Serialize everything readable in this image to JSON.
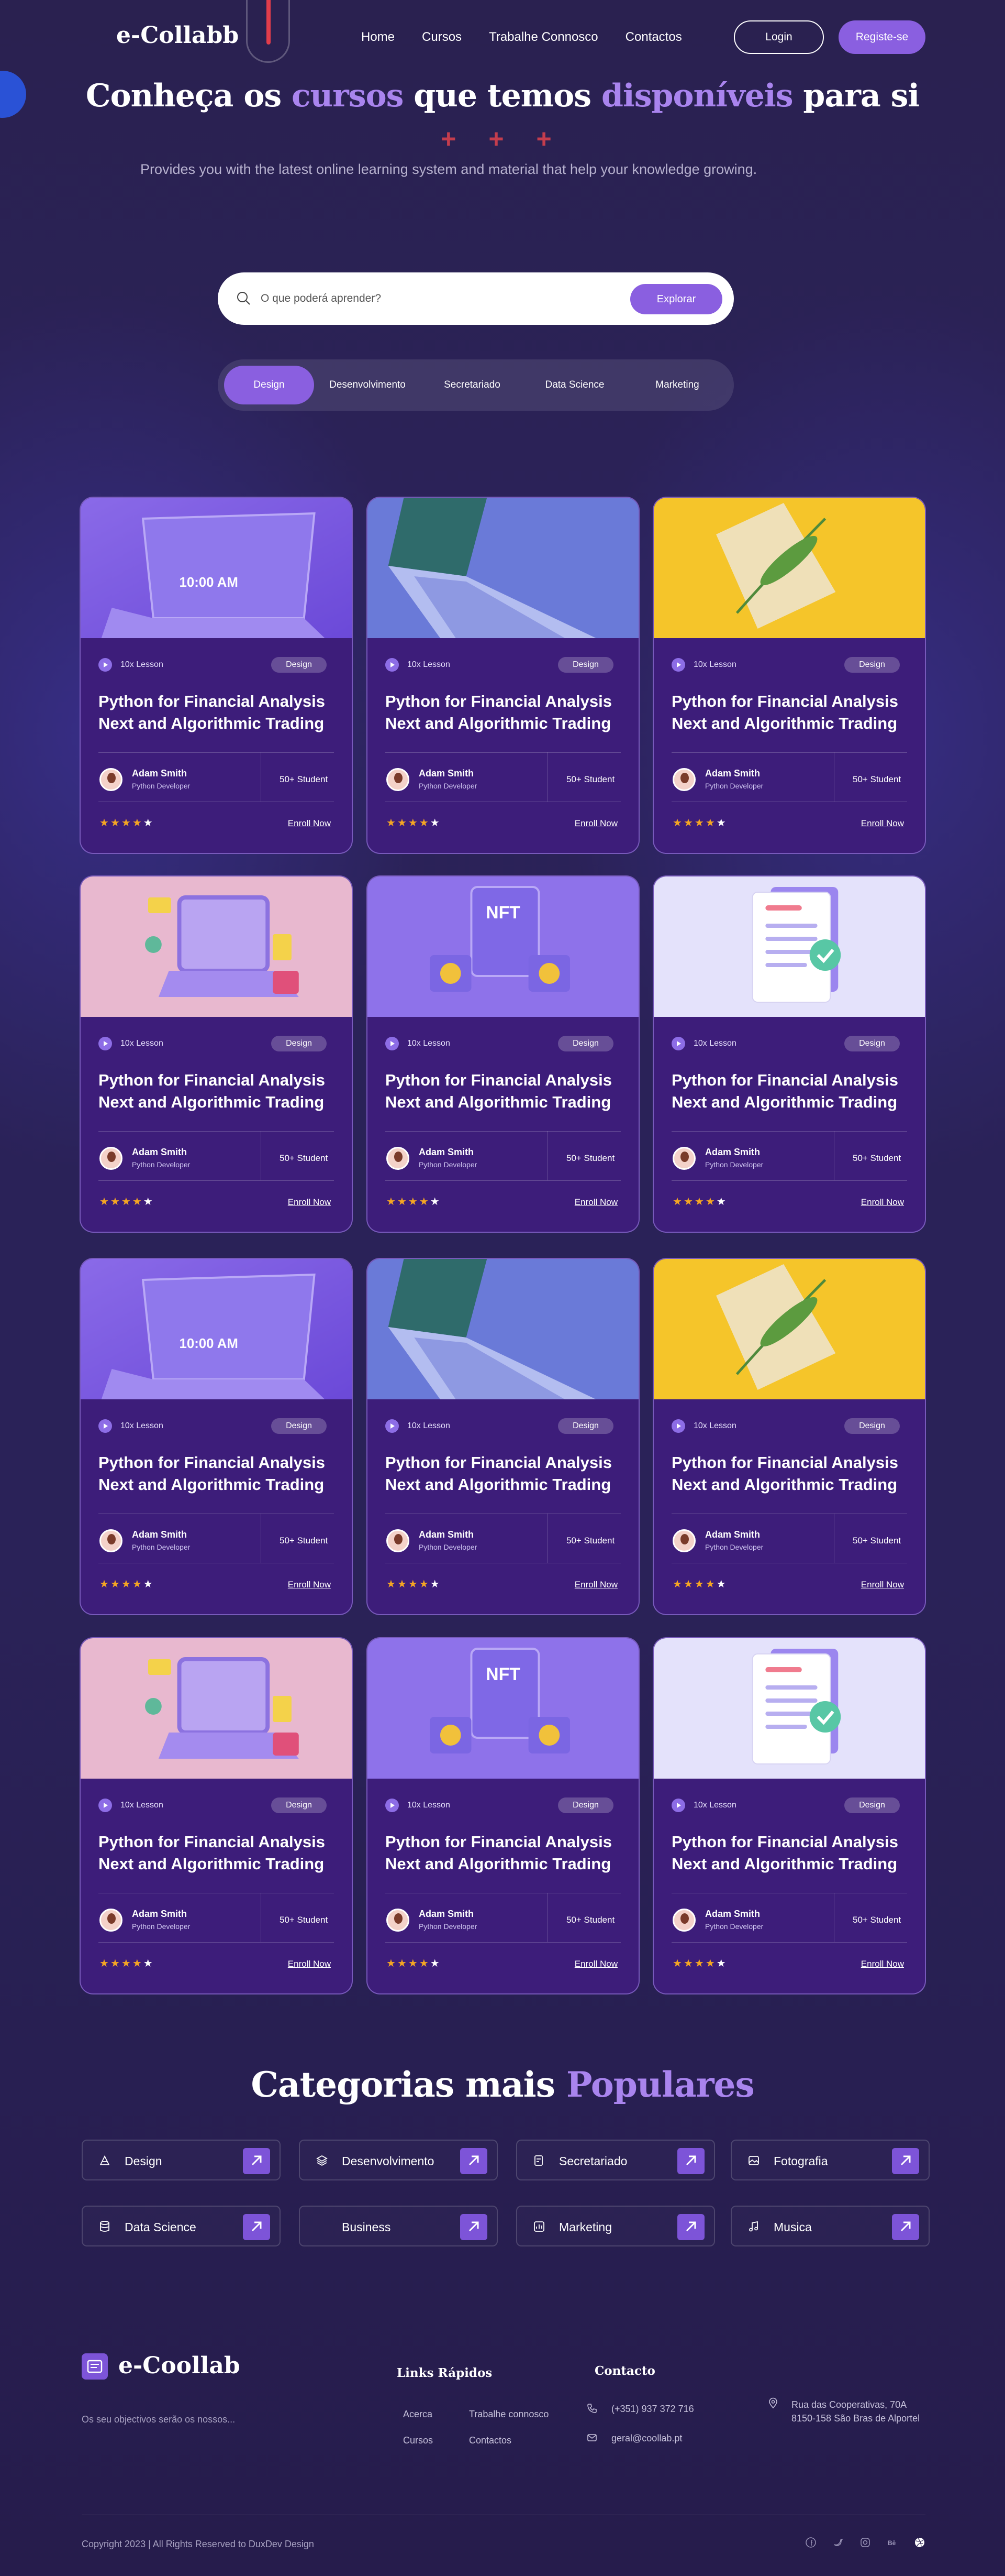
{
  "nav": {
    "logo": "e-Collabb",
    "links": [
      "Home",
      "Cursos",
      "Trabalhe Connosco",
      "Contactos"
    ],
    "login": "Login",
    "register": "Registe-se"
  },
  "hero": {
    "title_1": "Conheça os ",
    "title_hl1": "cursos",
    "title_2": " que temos ",
    "title_hl2": "disponíveis",
    "title_3": " para si",
    "plus": "+ + +",
    "subtitle": "Provides you with the latest online learning system and material that help your knowledge growing."
  },
  "search": {
    "placeholder": "O que poderá aprender?",
    "button": "Explorar"
  },
  "tabs": [
    {
      "label": "Design",
      "active": true
    },
    {
      "label": "Desenvolvimento",
      "active": false
    },
    {
      "label": "Secretariado",
      "active": false
    },
    {
      "label": "Data Science",
      "active": false
    },
    {
      "label": "Marketing",
      "active": false
    }
  ],
  "course_card": {
    "lesson": "10x Lesson",
    "tag": "Design",
    "title": "Python for Financial Analysis Next and Algorithmic Trading",
    "author": "Adam Smith",
    "role": "Python Developer",
    "students": "50+ Student",
    "rating": 4,
    "rating_max": 5,
    "enroll": "Enroll Now"
  },
  "course_images": [
    "laptop-purple",
    "laptop-blue",
    "plant-yellow",
    "laptop-pink",
    "nft-purple",
    "document-lavender"
  ],
  "course_image_text": {
    "time": "10:00 AM",
    "nft": "NFT"
  },
  "colors": {
    "accent": "#8a5fe0",
    "card_bg": "#3d1d7a",
    "star": "#f5a623",
    "highlight": "#a984ee",
    "plus": "#c43d4d"
  },
  "categories_section": {
    "title_1": "Categorias mais ",
    "title_hl": "Populares",
    "items": [
      {
        "label": "Design",
        "icon": "design-icon"
      },
      {
        "label": "Desenvolvimento",
        "icon": "layers-icon"
      },
      {
        "label": "Secretariado",
        "icon": "document-icon"
      },
      {
        "label": "Fotografia",
        "icon": "image-icon"
      },
      {
        "label": "Data Science",
        "icon": "database-icon"
      },
      {
        "label": "Business",
        "icon": ""
      },
      {
        "label": "Marketing",
        "icon": "chart-icon"
      },
      {
        "label": "Musica",
        "icon": "music-icon"
      }
    ]
  },
  "footer": {
    "logo": "e-Coollab",
    "tagline": "Os seu objectivos serão os nossos...",
    "links_title": "Links Rápidos",
    "links": [
      "Acerca",
      "Trabalhe connosco",
      "Cursos",
      "Contactos"
    ],
    "contact_title": "Contacto",
    "phone": "(+351) 937 372 716",
    "email": "geral@coollab.pt",
    "address_1": "Rua das Cooperativas, 70A",
    "address_2": "8150-158 São Bras de Alportel",
    "copyright": "Copyright 2023 | All Rights Reserved to DuxDev Design",
    "social": [
      "facebook-icon",
      "twitter-icon",
      "instagram-icon",
      "behance-icon",
      "dribbble-icon"
    ]
  }
}
